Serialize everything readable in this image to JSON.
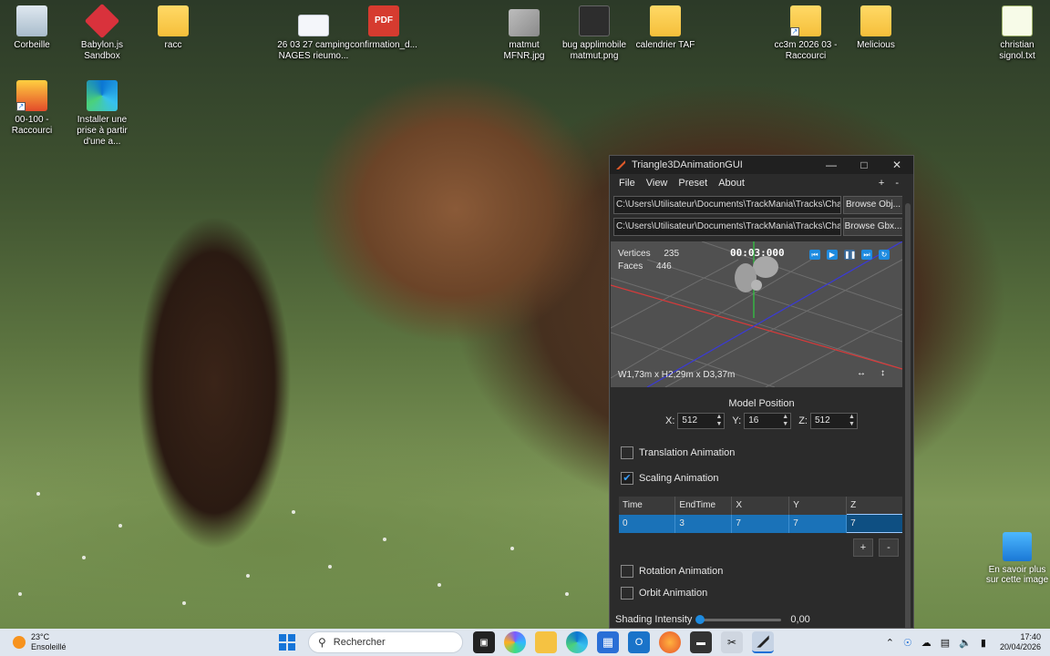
{
  "desktop": {
    "icons": [
      {
        "label": "Corbeille",
        "icon": "recycle-bin-icon"
      },
      {
        "label": "Babylon.js Sandbox",
        "icon": "babylon-icon"
      },
      {
        "label": "racc",
        "icon": "folder-icon"
      },
      {
        "label": "26 03 27 camping NAGES rieumo...",
        "icon": "document-icon"
      },
      {
        "label": "confirmation_d...",
        "icon": "pdf-icon"
      },
      {
        "label": "matmut MFNR.jpg",
        "icon": "image-icon"
      },
      {
        "label": "bug applimobile matmut.png",
        "icon": "image-icon"
      },
      {
        "label": "calendrier TAF",
        "icon": "folder-icon"
      },
      {
        "label": "cc3m 2026 03 - Raccourci",
        "icon": "folder-icon"
      },
      {
        "label": "Melicious",
        "icon": "folder-icon"
      },
      {
        "label": "christian signol.txt",
        "icon": "text-file-icon"
      },
      {
        "label": "00-100 - Raccourci",
        "icon": "folder-icon"
      },
      {
        "label": "Installer une prise à partir d'une a...",
        "icon": "edge-icon"
      }
    ],
    "learn_more": "En savoir plus sur cette image"
  },
  "app": {
    "title": "Triangle3DAnimationGUI",
    "menu": [
      "File",
      "View",
      "Preset",
      "About"
    ],
    "menu_plus": "+",
    "menu_minus": "-",
    "obj_path": "C:\\Users\\Utilisateur\\Documents\\TrackMania\\Tracks\\Challen",
    "gbx_path": "C:\\Users\\Utilisateur\\Documents\\TrackMania\\Tracks\\Challen",
    "browse_obj": "Browse Obj...",
    "browse_gbx": "Browse Gbx...",
    "viewport": {
      "vertices_label": "Vertices",
      "vertices": "235",
      "faces_label": "Faces",
      "faces": "446",
      "time": "00:03:000",
      "dims": "W1,73m x H2,29m x D3,37m",
      "ctl_horizontal": "↔",
      "ctl_vertical": "↕"
    },
    "model_position_title": "Model Position",
    "pos": {
      "x_label": "X:",
      "x": "512",
      "y_label": "Y:",
      "y": "16",
      "z_label": "Z:",
      "z": "512"
    },
    "translation_label": "Translation Animation",
    "translation_checked": false,
    "scaling_label": "Scaling Animation",
    "scaling_checked": true,
    "table": {
      "headers": [
        "Time",
        "EndTime",
        "X",
        "Y",
        "Z"
      ],
      "rows": [
        [
          "0",
          "3",
          "7",
          "7",
          "7"
        ]
      ]
    },
    "add_btn": "+",
    "remove_btn": "-",
    "rotation_label": "Rotation Animation",
    "orbit_label": "Orbit Animation",
    "shading_label": "Shading Intensity",
    "shading_value": "0,00"
  },
  "taskbar": {
    "weather_temp": "23°C",
    "weather_desc": "Ensoleillé",
    "search_placeholder": "Rechercher",
    "time": "17:40",
    "date": "20/04/2026"
  }
}
